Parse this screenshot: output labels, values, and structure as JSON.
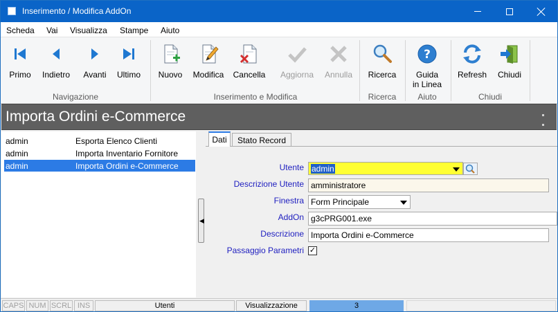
{
  "window": {
    "title": "Inserimento / Modifica AddOn"
  },
  "menu": [
    "Scheda",
    "Vai",
    "Visualizza",
    "Stampe",
    "Aiuto"
  ],
  "ribbon": {
    "groups": {
      "navigazione": "Navigazione",
      "inserimento": "Inserimento e Modifica",
      "ricerca": "Ricerca",
      "aiuto": "Aiuto",
      "chiudi": "Chiudi"
    },
    "buttons": {
      "primo": "Primo",
      "indietro": "Indietro",
      "avanti": "Avanti",
      "ultimo": "Ultimo",
      "nuovo": "Nuovo",
      "modifica": "Modifica",
      "cancella": "Cancella",
      "aggiorna": "Aggiorna",
      "annulla": "Annulla",
      "ricerca": "Ricerca",
      "guida_1": "Guida",
      "guida_2": "in Linea",
      "refresh": "Refresh",
      "chiudi": "Chiudi"
    },
    "icons": {
      "primo": "first-record-icon",
      "indietro": "previous-record-icon",
      "avanti": "next-record-icon",
      "ultimo": "last-record-icon",
      "nuovo": "new-document-icon",
      "modifica": "edit-document-icon",
      "cancella": "delete-document-icon",
      "aggiorna": "checkmark-icon",
      "annulla": "cancel-x-icon",
      "ricerca": "magnifier-icon",
      "guida": "help-icon",
      "refresh": "refresh-icon",
      "chiudi": "exit-door-icon"
    }
  },
  "header": {
    "title": "Importa Ordini e-Commerce"
  },
  "list": {
    "rows": [
      {
        "user": "admin",
        "name": "Esporta Elenco Clienti",
        "selected": false
      },
      {
        "user": "admin",
        "name": "Importa Inventario Fornitore",
        "selected": false
      },
      {
        "user": "admin",
        "name": "Importa Ordini e-Commerce",
        "selected": true
      }
    ]
  },
  "tabs": [
    "Dati",
    "Stato Record"
  ],
  "form": {
    "utente_label": "Utente",
    "utente_value": "admin",
    "descrizione_utente_label": "Descrizione Utente",
    "descrizione_utente_value": "amministratore",
    "finestra_label": "Finestra",
    "finestra_value": "Form Principale",
    "addon_label": "AddOn",
    "addon_value": "g3cPRG001.exe",
    "descrizione_label": "Descrizione",
    "descrizione_value": "Importa Ordini e-Commerce",
    "passaggio_label": "Passaggio Parametri",
    "passaggio_checked": "✓"
  },
  "status": {
    "caps": "CAPS",
    "num": "NUM",
    "scrl": "SCRL",
    "ins": "INS",
    "table": "Utenti",
    "mode": "Visualizzazione",
    "count": "3"
  },
  "colors": {
    "titlebar": "#0a64c8",
    "header_band": "#5f5f5f",
    "selection": "#2c7be5",
    "field_label": "#1d1dbf",
    "highlight_field": "#ffff33",
    "status_count": "#6ea8e6"
  }
}
